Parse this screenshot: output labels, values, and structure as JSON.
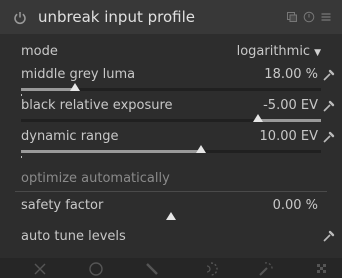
{
  "header": {
    "title": "unbreak input profile"
  },
  "mode": {
    "label": "mode",
    "value": "logarithmic"
  },
  "middle_grey_luma": {
    "label": "middle grey luma",
    "value": "18.00 %",
    "level": 0.18
  },
  "black_relative_exposure": {
    "label": "black relative exposure",
    "value": "-5.00 EV",
    "level": 0.79
  },
  "dynamic_range": {
    "label": "dynamic range",
    "value": "10.00 EV",
    "level": 0.6
  },
  "optimize": {
    "label": "optimize automatically"
  },
  "safety_factor": {
    "label": "safety factor",
    "value": "0.00 %",
    "level": 0.5
  },
  "auto_tune": {
    "label": "auto tune levels"
  },
  "icons": {
    "power": "power-icon",
    "header": [
      "presets-icon",
      "reset-icon",
      "menu-icon"
    ],
    "picker": "color-picker-icon",
    "toolbar": [
      "close-icon",
      "circle-icon",
      "line-icon",
      "ellipse-icon",
      "path-icon",
      "brush-icon"
    ]
  },
  "colors": {
    "background": "#2d2d2d",
    "header": "#383838",
    "text": "#c8c8c8",
    "section": "#8a8a8a",
    "slider_fill": "#9a9a9a",
    "thumb": "#e6e6e6"
  }
}
